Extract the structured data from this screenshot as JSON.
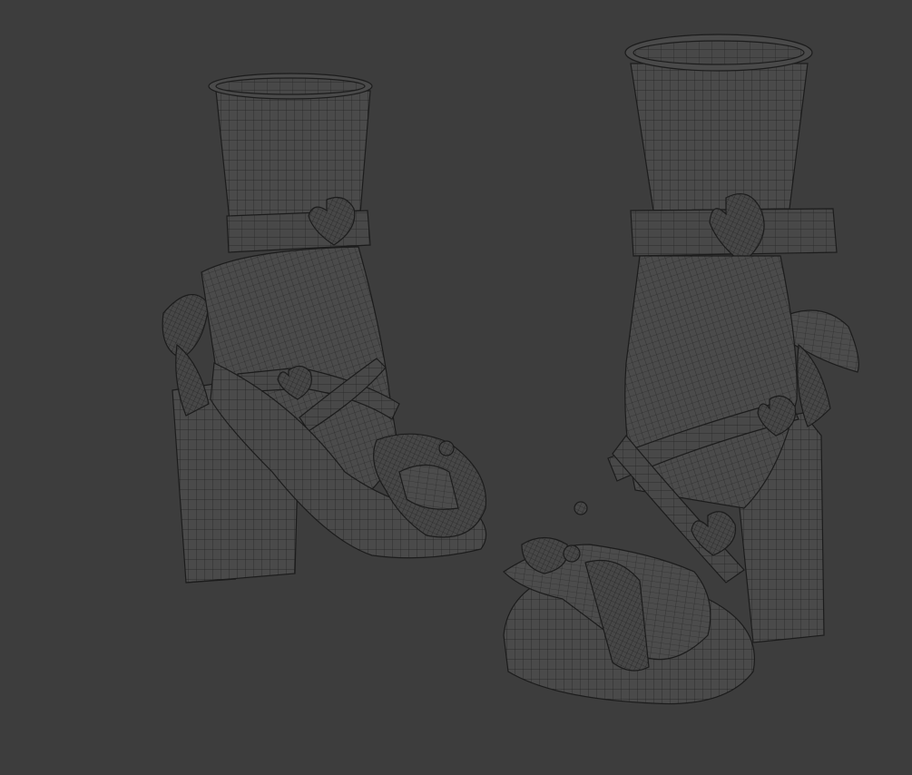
{
  "viewport": {
    "background": "#3d3d3d",
    "wire_color": "#1b1b1b",
    "surface_color": "#4a4a4a"
  },
  "scene": {
    "objects": [
      {
        "id": "left-shoe",
        "icon": "wireframe-mesh"
      },
      {
        "id": "right-shoe",
        "icon": "wireframe-mesh"
      }
    ]
  }
}
